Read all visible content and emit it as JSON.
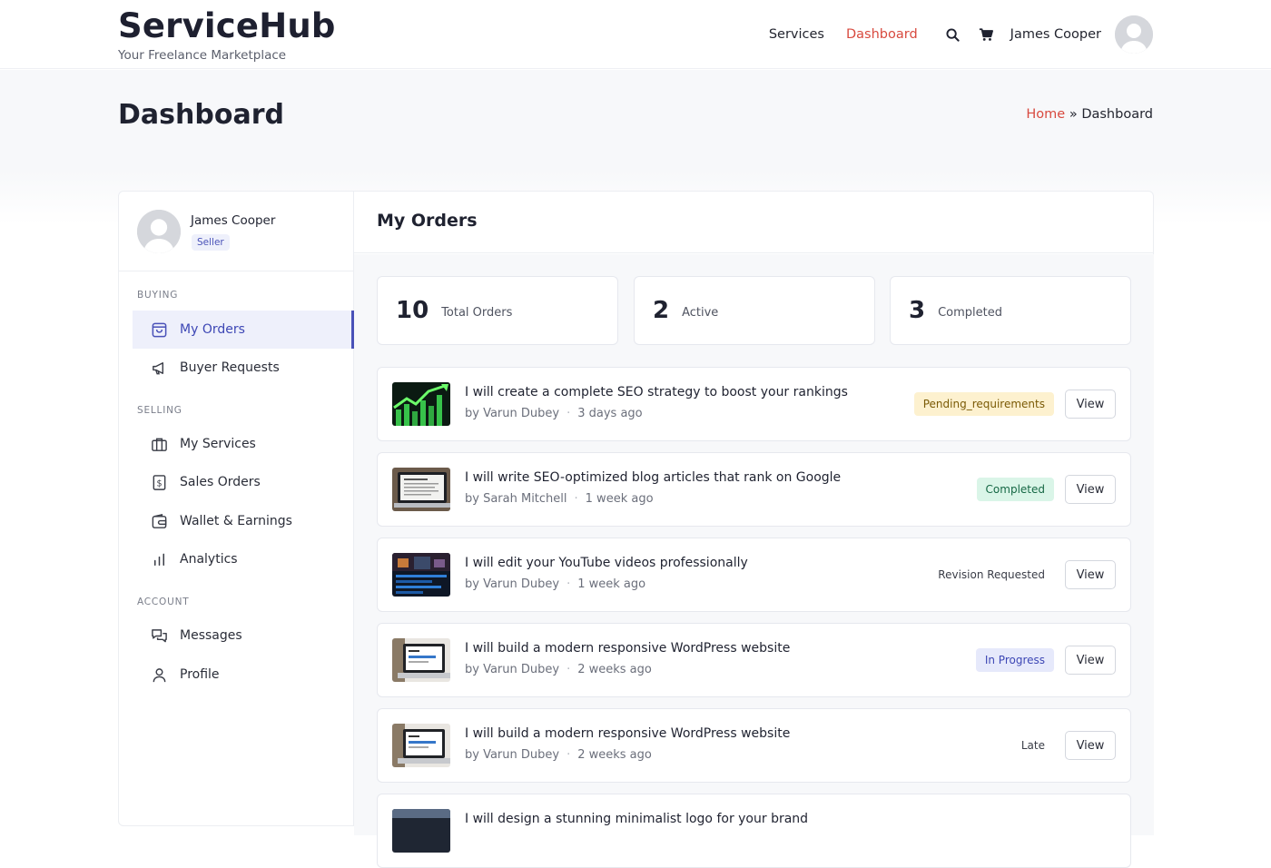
{
  "brand": {
    "name": "ServiceHub",
    "tagline": "Your Freelance Marketplace"
  },
  "nav": {
    "links": [
      {
        "label": "Services",
        "active": false
      },
      {
        "label": "Dashboard",
        "active": true
      }
    ],
    "icons": [
      "search-icon",
      "cart-icon"
    ],
    "user_name": "James Cooper"
  },
  "page": {
    "title": "Dashboard",
    "breadcrumb": {
      "home": "Home",
      "separator": "»",
      "current": "Dashboard"
    }
  },
  "sidebar": {
    "profile": {
      "name": "James Cooper",
      "role": "Seller"
    },
    "sections": [
      {
        "label": "BUYING",
        "items": [
          {
            "label": "My Orders",
            "icon": "shopping-bag-icon",
            "active": true
          },
          {
            "label": "Buyer Requests",
            "icon": "megaphone-icon",
            "active": false
          }
        ]
      },
      {
        "label": "SELLING",
        "items": [
          {
            "label": "My Services",
            "icon": "briefcase-icon",
            "active": false
          },
          {
            "label": "Sales Orders",
            "icon": "dollar-receipt-icon",
            "active": false
          },
          {
            "label": "Wallet & Earnings",
            "icon": "wallet-icon",
            "active": false
          },
          {
            "label": "Analytics",
            "icon": "bar-chart-icon",
            "active": false
          }
        ]
      },
      {
        "label": "ACCOUNT",
        "items": [
          {
            "label": "Messages",
            "icon": "chat-icon",
            "active": false
          },
          {
            "label": "Profile",
            "icon": "user-icon",
            "active": false
          }
        ]
      }
    ]
  },
  "main": {
    "title": "My Orders",
    "stats": [
      {
        "value": "10",
        "label": "Total Orders"
      },
      {
        "value": "2",
        "label": "Active"
      },
      {
        "value": "3",
        "label": "Completed"
      }
    ],
    "orders": [
      {
        "title": "I will create a complete SEO strategy to boost your rankings",
        "seller": "by Varun Dubey",
        "time": "3 days ago",
        "status": "Pending_requirements",
        "status_style": "pending",
        "thumb": "seo-chart",
        "action": "View"
      },
      {
        "title": "I will write SEO-optimized blog articles that rank on Google",
        "seller": "by Sarah Mitchell",
        "time": "1 week ago",
        "status": "Completed",
        "status_style": "completed",
        "thumb": "laptop-doc",
        "action": "View"
      },
      {
        "title": "I will edit your YouTube videos professionally",
        "seller": "by Varun Dubey",
        "time": "1 week ago",
        "status": "Revision Requested",
        "status_style": "revision",
        "thumb": "video-editing",
        "action": "View"
      },
      {
        "title": "I will build a modern responsive WordPress website",
        "seller": "by Varun Dubey",
        "time": "2 weeks ago",
        "status": "In Progress",
        "status_style": "progress",
        "thumb": "laptop-web",
        "action": "View"
      },
      {
        "title": "I will build a modern responsive WordPress website",
        "seller": "by Varun Dubey",
        "time": "2 weeks ago",
        "status": "Late",
        "status_style": "late",
        "thumb": "laptop-web",
        "action": "View"
      }
    ],
    "partial_order": {
      "title": "I will design a stunning minimalist logo for your brand"
    }
  },
  "colors": {
    "accent_red": "#d84a3f",
    "accent_indigo": "#4a52b8"
  }
}
